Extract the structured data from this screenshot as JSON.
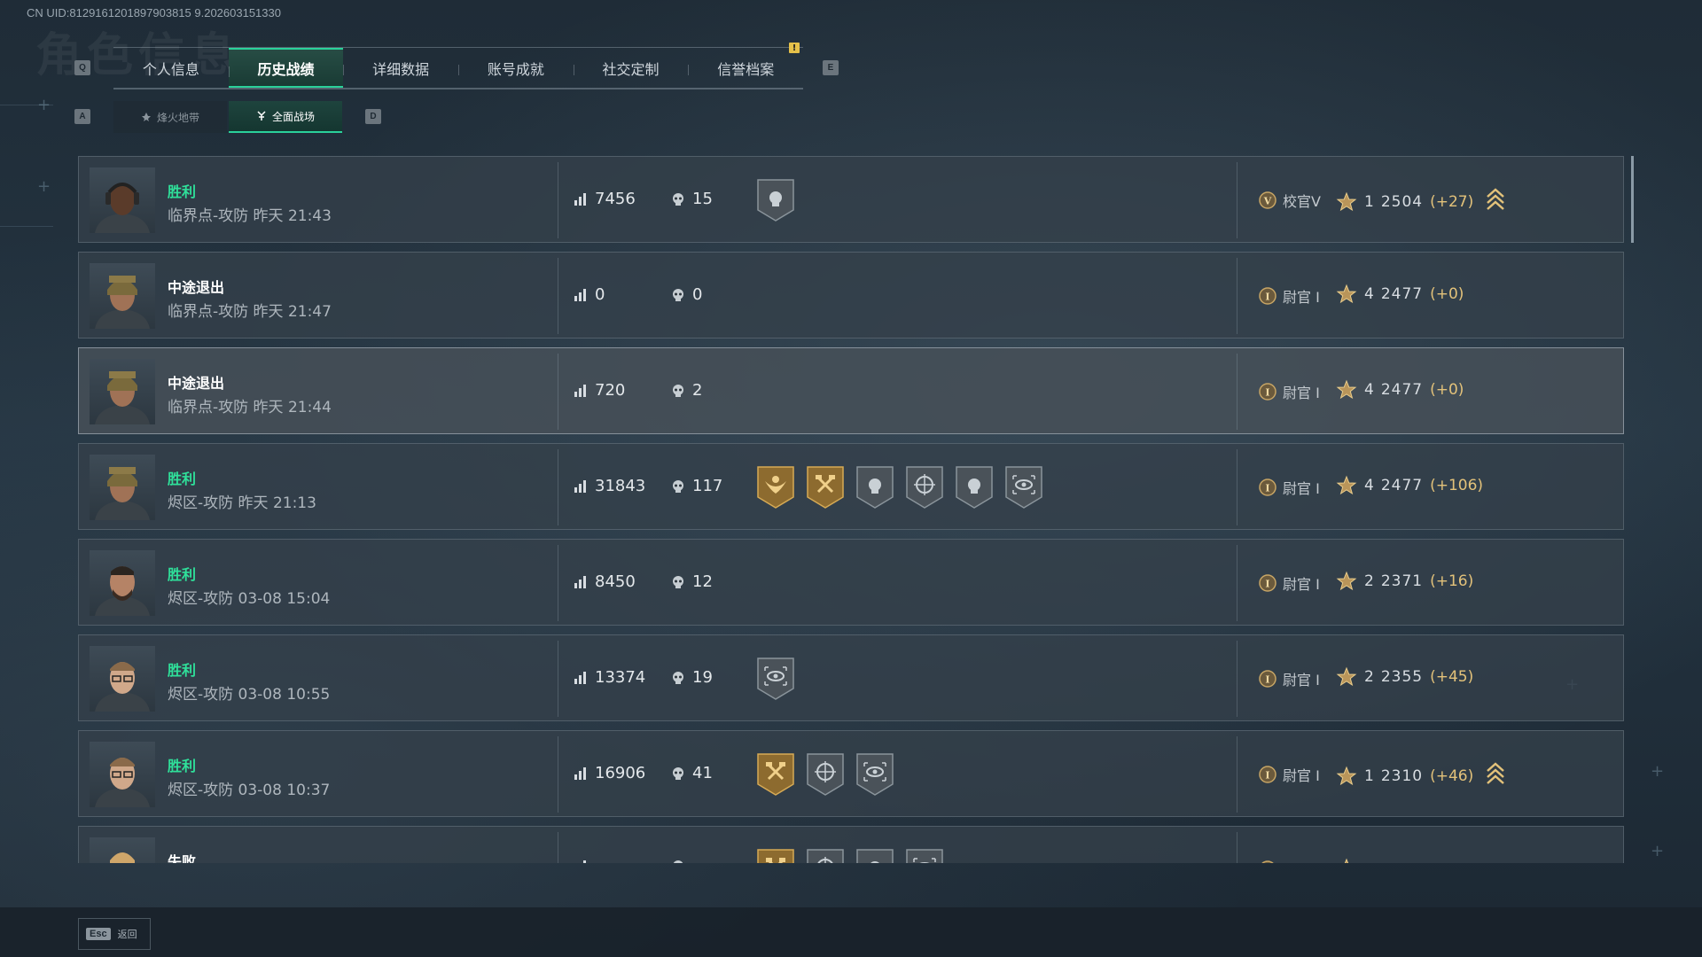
{
  "uid": "CN UID:8129161201897903815 9.202603151330",
  "bg_title": "角色信息",
  "keys": {
    "prev_tab": "Q",
    "next_tab": "E",
    "prev_sub": "A",
    "next_sub": "D",
    "back": "Esc"
  },
  "tabs": [
    {
      "label": "个人信息",
      "active": false
    },
    {
      "label": "历史战绩",
      "active": true
    },
    {
      "label": "详细数据",
      "active": false
    },
    {
      "label": "账号成就",
      "active": false
    },
    {
      "label": "社交定制",
      "active": false
    },
    {
      "label": "信誉档案",
      "active": false
    }
  ],
  "tab_badge": "!",
  "subtabs": [
    {
      "label": "烽火地带",
      "active": false
    },
    {
      "label": "全面战场",
      "active": true
    }
  ],
  "back_label": "返回",
  "colors": {
    "accent": "#2ad19a",
    "win": "#2fe09a",
    "gold": "#e3c27a"
  },
  "matches": [
    {
      "result": "胜利",
      "result_type": "win",
      "map": "临界点-攻防 昨天 21:43",
      "avatar": "operator-dark",
      "score": "7456",
      "kills": "15",
      "medals": [
        "skull-grey"
      ],
      "rank": "校官V",
      "rank_icon": "rank-v-icon",
      "stars": "1",
      "rating": "2504",
      "delta": "(+27)",
      "promo": true
    },
    {
      "result": "中途退出",
      "result_type": "quit",
      "map": "临界点-攻防 昨天 21:47",
      "avatar": "operator-helmet",
      "score": "0",
      "kills": "0",
      "medals": [],
      "rank": "尉官 I",
      "rank_icon": "rank-i-icon",
      "stars": "4",
      "rating": "2477",
      "delta": "(+0)",
      "promo": false
    },
    {
      "result": "中途退出",
      "result_type": "quit",
      "map": "临界点-攻防 昨天 21:44",
      "avatar": "operator-helmet",
      "score": "720",
      "kills": "2",
      "medals": [],
      "rank": "尉官 I",
      "rank_icon": "rank-i-icon",
      "stars": "4",
      "rating": "2477",
      "delta": "(+0)",
      "promo": false,
      "highlight": true
    },
    {
      "result": "胜利",
      "result_type": "win",
      "map": "烬区-攻防 昨天 21:13",
      "avatar": "operator-helmet",
      "score": "31843",
      "kills": "117",
      "medals": [
        "eagle-gold",
        "hammers-gold",
        "skull-grey",
        "crosshair-grey",
        "skull-grey",
        "eye-grey"
      ],
      "rank": "尉官 I",
      "rank_icon": "rank-i-icon",
      "stars": "4",
      "rating": "2477",
      "delta": "(+106)",
      "promo": false
    },
    {
      "result": "胜利",
      "result_type": "win",
      "map": "烬区-攻防 03-08 15:04",
      "avatar": "operator-beard",
      "score": "8450",
      "kills": "12",
      "medals": [],
      "rank": "尉官 I",
      "rank_icon": "rank-i-icon",
      "stars": "2",
      "rating": "2371",
      "delta": "(+16)",
      "promo": false
    },
    {
      "result": "胜利",
      "result_type": "win",
      "map": "烬区-攻防 03-08 10:55",
      "avatar": "operator-glasses",
      "score": "13374",
      "kills": "19",
      "medals": [
        "eye-grey"
      ],
      "rank": "尉官 I",
      "rank_icon": "rank-i-icon",
      "stars": "2",
      "rating": "2355",
      "delta": "(+45)",
      "promo": false
    },
    {
      "result": "胜利",
      "result_type": "win",
      "map": "烬区-攻防 03-08 10:37",
      "avatar": "operator-glasses",
      "score": "16906",
      "kills": "41",
      "medals": [
        "hammers-gold",
        "crosshair-grey",
        "eye-grey"
      ],
      "rank": "尉官 I",
      "rank_icon": "rank-i-icon",
      "stars": "1",
      "rating": "2310",
      "delta": "(+46)",
      "promo": true
    },
    {
      "result": "失败",
      "result_type": "lose",
      "map": "",
      "avatar": "operator-blond",
      "score": "",
      "kills": "",
      "medals": [
        "hammers-gold",
        "crosshair-grey",
        "skull-grey",
        "eye-grey"
      ],
      "rank": "",
      "rank_icon": "rank-i-icon",
      "stars": "",
      "rating": "",
      "delta": "",
      "promo": false
    }
  ]
}
